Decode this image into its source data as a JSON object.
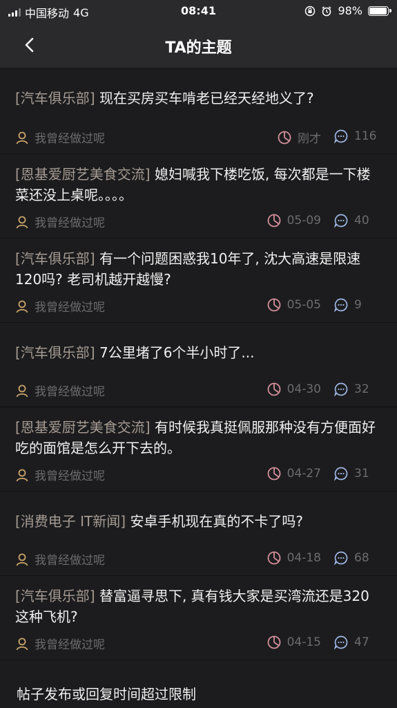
{
  "status": {
    "carrier": "中国移动",
    "network": "4G",
    "time": "08:41",
    "battery": "98%",
    "battery_level": 0.98
  },
  "nav": {
    "title": "TA的主题",
    "back_icon": "chevron-left-icon"
  },
  "topics": [
    {
      "forum": "[汽车俱乐部]",
      "title": "现在买房买车啃老已经天经地义了?",
      "author": "我曾经做过呢",
      "time": "刚才",
      "replies": "116"
    },
    {
      "forum": "[恩基爱厨艺美食交流]",
      "title": "媳妇喊我下楼吃饭, 每次都是一下楼菜还没上桌呢。。。。",
      "author": "我曾经做过呢",
      "time": "05-09",
      "replies": "40"
    },
    {
      "forum": "[汽车俱乐部]",
      "title": "有一个问题困惑我10年了, 沈大高速是限速120吗? 老司机越开越慢?",
      "author": "我曾经做过呢",
      "time": "05-05",
      "replies": "9"
    },
    {
      "forum": "[汽车俱乐部]",
      "title": "7公里堵了6个半小时了...",
      "author": "我曾经做过呢",
      "time": "04-30",
      "replies": "32"
    },
    {
      "forum": "[恩基爱厨艺美食交流]",
      "title": "有时候我真挺佩服那种没有方便面好吃的面馆是怎么开下去的。",
      "author": "我曾经做过呢",
      "time": "04-27",
      "replies": "31"
    },
    {
      "forum": "[消费电子 IT新闻]",
      "title": "安卓手机现在真的不卡了吗?",
      "author": "我曾经做过呢",
      "time": "04-18",
      "replies": "68"
    },
    {
      "forum": "[汽车俱乐部]",
      "title": "替富逼寻思下, 真有钱大家是买湾流还是320这种飞机?",
      "author": "我曾经做过呢",
      "time": "04-15",
      "replies": "47"
    }
  ],
  "footer": {
    "notice": "帖子发布或回复时间超过限制"
  },
  "colors": {
    "background": "#1c1c1e",
    "bar": "#2a2a2c",
    "forum_tag": "#a59b92",
    "user_icon": "#c9a36a",
    "clock_icon": "#d4909b",
    "comment_icon": "#9fb8e6",
    "meta_text": "#6c6c6e"
  }
}
